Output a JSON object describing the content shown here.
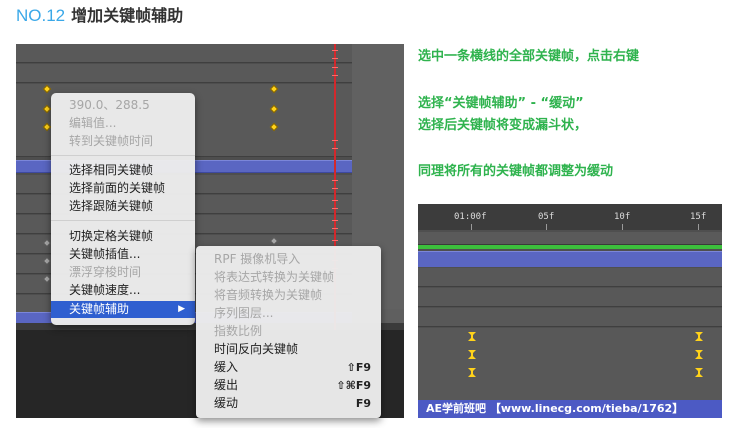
{
  "heading": {
    "number": "NO.12",
    "title": "增加关键帧辅助"
  },
  "context_menu": {
    "items": [
      {
        "label": "390.0、288.5",
        "disabled": true
      },
      {
        "label": "编辑值...",
        "disabled": true
      },
      {
        "label": "转到关键帧时间",
        "disabled": true
      },
      {
        "label": "选择相同关键帧",
        "disabled": false
      },
      {
        "label": "选择前面的关键帧",
        "disabled": false
      },
      {
        "label": "选择跟随关键帧",
        "disabled": false
      },
      {
        "label": "切换定格关键帧",
        "disabled": false
      },
      {
        "label": "关键帧插值...",
        "disabled": false
      },
      {
        "label": "漂浮穿梭时间",
        "disabled": true
      },
      {
        "label": "关键帧速度...",
        "disabled": false
      },
      {
        "label": "关键帧辅助",
        "disabled": false,
        "highlighted": true
      }
    ],
    "submenu_arrow": "▶"
  },
  "submenu": {
    "items": [
      {
        "label": "RPF 摄像机导入",
        "disabled": true,
        "shortcut": ""
      },
      {
        "label": "将表达式转换为关键帧",
        "disabled": true,
        "shortcut": ""
      },
      {
        "label": "将音频转换为关键帧",
        "disabled": true,
        "shortcut": ""
      },
      {
        "label": "序列图层...",
        "disabled": true,
        "shortcut": ""
      },
      {
        "label": "指数比例",
        "disabled": true,
        "shortcut": ""
      },
      {
        "label": "时间反向关键帧",
        "disabled": false,
        "shortcut": ""
      },
      {
        "label": "缓入",
        "disabled": false,
        "shortcut": "⇧F9"
      },
      {
        "label": "缓出",
        "disabled": false,
        "shortcut": "⇧⌘F9"
      },
      {
        "label": "缓动",
        "disabled": false,
        "shortcut": "F9"
      }
    ]
  },
  "instructions": {
    "line1": "选中一条横线的全部关键帧，点击右键",
    "line2": "选择“关键帧辅助” - “缓动”",
    "line3": "选择后关键帧将变成漏斗状，",
    "line4": "同理将所有的关键帧都调整为缓动"
  },
  "timeline_ruler": {
    "ticks": [
      "01:00f",
      "05f",
      "10f",
      "15f"
    ]
  },
  "watermark": {
    "text": "AE学前班吧 【www.linecg.com/tieba/1762】"
  },
  "colors": {
    "accent_blue": "#3aa8e8",
    "instruction_green": "#2fb34e",
    "keyframe_yellow": "#ffd21a",
    "selection_purple": "#5a66c2",
    "menu_highlight": "#2f5fd0",
    "playhead_red": "#d3282c"
  },
  "icons": {
    "keyframe": "diamond-keyframe-icon",
    "easy_ease_keyframe": "hourglass-keyframe-icon",
    "submenu": "triangle-right-icon"
  }
}
